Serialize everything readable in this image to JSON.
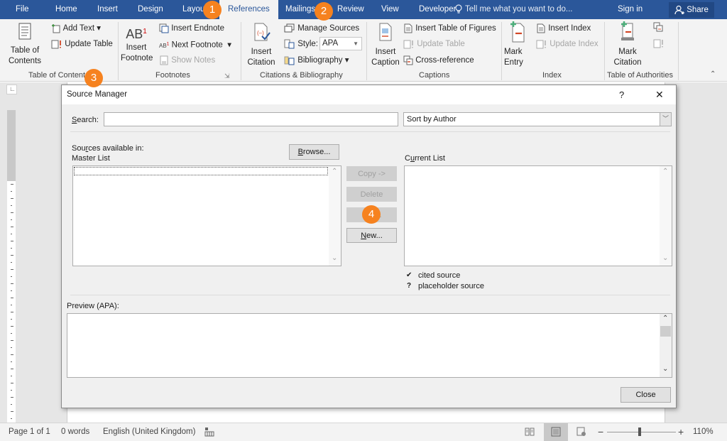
{
  "tabs": [
    {
      "label": "File"
    },
    {
      "label": "Home"
    },
    {
      "label": "Insert"
    },
    {
      "label": "Design"
    },
    {
      "label": "Layout"
    },
    {
      "label": "References"
    },
    {
      "label": "Mailings"
    },
    {
      "label": "Review"
    },
    {
      "label": "View"
    },
    {
      "label": "Developer"
    }
  ],
  "active_tab": "References",
  "tell_me": "Tell me what you want to do...",
  "sign_in": "Sign in",
  "share": "Share",
  "ribbon": {
    "toc": {
      "big": "Table of\nContents",
      "add_text": "Add Text",
      "update_table": "Update Table",
      "label": "Table of Contents"
    },
    "footnotes": {
      "big": "Insert\nFootnote",
      "insert_endnote": "Insert Endnote",
      "next_footnote": "Next Footnote",
      "show_notes": "Show Notes",
      "label": "Footnotes"
    },
    "citations": {
      "big": "Insert\nCitation",
      "manage_sources": "Manage Sources",
      "style_label": "Style:",
      "style_value": "APA",
      "bibliography": "Bibliography",
      "label": "Citations & Bibliography"
    },
    "captions": {
      "big": "Insert\nCaption",
      "insert_tof": "Insert Table of Figures",
      "update_table": "Update Table",
      "cross_reference": "Cross-reference",
      "label": "Captions"
    },
    "index": {
      "big": "Mark\nEntry",
      "insert_index": "Insert Index",
      "update_index": "Update Index",
      "label": "Index"
    },
    "toa": {
      "big": "Mark\nCitation",
      "label": "Table of Authorities"
    }
  },
  "badges": [
    "1",
    "2",
    "3",
    "4"
  ],
  "dialog": {
    "title": "Source Manager",
    "help": "?",
    "close_x": "✕",
    "search_label_u": "S",
    "search_label_rest": "earch:",
    "search_value": "",
    "sort_value": "Sort by Author",
    "sources_label_pre": "Sou",
    "sources_label_u": "r",
    "sources_label_post": "ces available in:",
    "master_list": "Master List",
    "browse_u": "B",
    "browse_rest": "rowse...",
    "current_pre": "C",
    "current_u": "u",
    "current_post": "rrent List",
    "copy": "Copy ->",
    "delete": "Delete",
    "edit": "Edit...",
    "new_u": "N",
    "new_rest": "ew...",
    "legend": [
      {
        "symbol": "✔",
        "text": "cited source"
      },
      {
        "symbol": "?",
        "text": "placeholder source"
      }
    ],
    "preview_label": "Preview (APA):",
    "close_btn": "Close"
  },
  "status": {
    "page": "Page 1 of 1",
    "words": "0 words",
    "language": "English (United Kingdom)",
    "zoom": "110%",
    "zoom_minus": "−",
    "zoom_plus": "+"
  },
  "colors": {
    "brand": "#2b579a",
    "badge": "#f6821f"
  }
}
